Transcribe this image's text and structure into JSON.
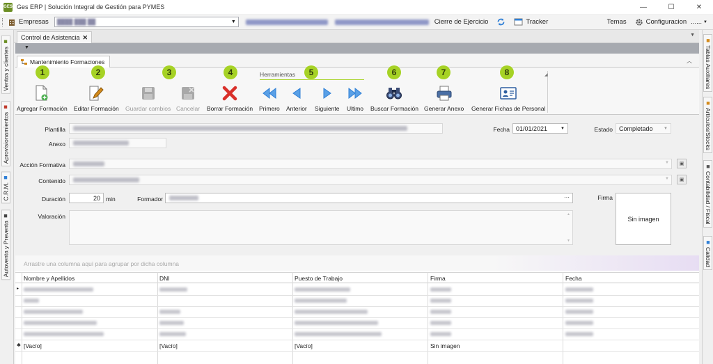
{
  "window": {
    "title": "Ges ERP | Solución Integral de Gestión para PYMES",
    "logo_text": "GES",
    "controls": [
      "—",
      "☐",
      "✕"
    ]
  },
  "menubar": {
    "empresas_label": "Empresas",
    "cierre_label": "Cierre de Ejercicio",
    "tracker_label": "Tracker",
    "temas_label": "Temas",
    "config_label": "Configuracion",
    "more_label": "......"
  },
  "doc_tab": {
    "label": "Control de Asistencia",
    "close": "✕"
  },
  "left_sidebar": [
    "Ventas y clientes",
    "Aprovisionamientos",
    "C.R.M.",
    "Autoventa y Preventa"
  ],
  "right_sidebar": [
    "Tablas Auxiliares",
    "Artículos/Stocks",
    "Contabilidad / Fiscal",
    "Calidad"
  ],
  "subtab": {
    "label": "Mantenimiento Formaciones"
  },
  "ribbon": {
    "group_label": "Herramientas",
    "buttons": [
      {
        "label": "Agregar Formación",
        "badge": "1",
        "enabled": true
      },
      {
        "label": "Editar Formación",
        "badge": "2",
        "enabled": true
      },
      {
        "label": "Guardar cambios",
        "badge": "3",
        "enabled": false
      },
      {
        "label": "Cancelar",
        "badge": "",
        "enabled": false
      },
      {
        "label": "Borrar Formación",
        "badge": "4",
        "enabled": true
      },
      {
        "label": "Primero",
        "badge": "",
        "enabled": true
      },
      {
        "label": "Anterior",
        "badge": "",
        "enabled": true
      },
      {
        "label": "Siguiente",
        "badge": "5",
        "enabled": true
      },
      {
        "label": "Ultimo",
        "badge": "",
        "enabled": true
      },
      {
        "label": "Buscar Formación",
        "badge": "6",
        "enabled": true
      },
      {
        "label": "Generar Anexo",
        "badge": "7",
        "enabled": true
      },
      {
        "label": "Generar Fichas de Personal",
        "badge": "8",
        "enabled": true
      }
    ]
  },
  "form": {
    "plantilla_label": "Plantilla",
    "anexo_label": "Anexo",
    "fecha_label": "Fecha",
    "fecha_value": "01/01/2021",
    "estado_label": "Estado",
    "estado_value": "Completado",
    "accion_label": "Acción Formativa",
    "contenido_label": "Contenido",
    "duracion_label": "Duración",
    "duracion_value": "20",
    "duracion_unit": "min",
    "formador_label": "Formador",
    "formador_more": "···",
    "valoracion_label": "Valoración",
    "firma_label": "Firma",
    "firma_placeholder": "Sin imagen"
  },
  "grid": {
    "group_hint": "Arrastre una columna aquí para agrupar por dicha columna",
    "columns": [
      "Nombre y Apellidos",
      "DNI",
      "Puesto de Trabajo",
      "Firma",
      "Fecha"
    ],
    "new_row": [
      "[Vacío]",
      "[Vacío]",
      "[Vacío]",
      "Sin imagen",
      ""
    ],
    "new_row_marker": "✱",
    "current_row_marker": "▸"
  },
  "colors": {
    "accent_badge": "#a6d225",
    "delete_red": "#d9302a",
    "nav_blue": "#2f7fd6"
  }
}
